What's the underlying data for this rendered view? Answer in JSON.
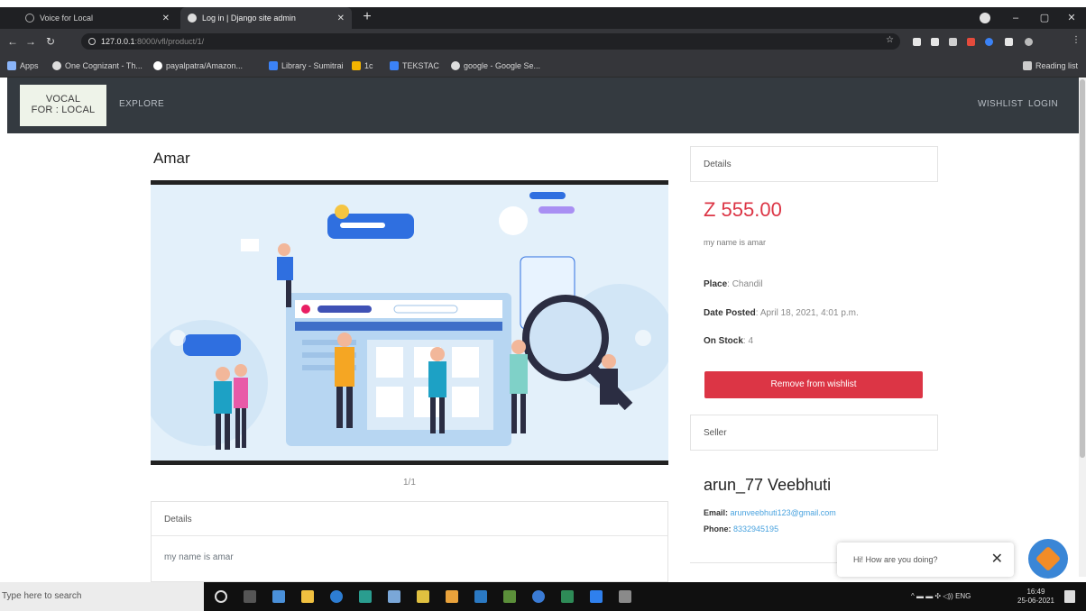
{
  "browser": {
    "tabs": [
      {
        "title": "Voice for Local"
      },
      {
        "title": "Log in | Django site admin",
        "active": true
      }
    ],
    "address": {
      "host": "127.0.0.1",
      "path": ":8000/vfl/product/1/"
    },
    "bookmarks": [
      "Apps",
      "One Cognizant - Th...",
      "payalpatra/Amazon...",
      "Library - Sumitrai",
      "1c",
      "TEKSTAC",
      "google - Google Se..."
    ],
    "reading_list": "Reading list",
    "colors": {
      "chrome": "#35363a",
      "tabstrip": "#1f2023"
    }
  },
  "site": {
    "logo": {
      "line1": "VOCAL",
      "line2": "FOR : LOCAL"
    },
    "nav": {
      "explore": "EXPLORE",
      "wishlist": "WISHLIST",
      "login": "LOGIN"
    },
    "colors": {
      "navbar": "#343a40",
      "accent": "#dc3545"
    }
  },
  "product": {
    "title": "Amar",
    "image_counter": "1/1",
    "details_label": "Details",
    "description": "my name is amar"
  },
  "sidebar": {
    "details_label": "Details",
    "price": "Z 555.00",
    "description": "my name is amar",
    "place_label": "Place",
    "place_value": "Chandil",
    "date_label": "Date Posted",
    "date_value": "April 18, 2021, 4:01 p.m.",
    "stock_label": "On Stock",
    "stock_value": "4",
    "remove_button": "Remove from wishlist",
    "seller_label": "Seller",
    "seller_name": "arun_77 Veebhuti",
    "email_label": "Email:",
    "email_value": "arunveebhuti123@gmail.com",
    "phone_label": "Phone:",
    "phone_value": "8332945195"
  },
  "chat": {
    "message": "Hi! How are you doing?"
  },
  "taskbar": {
    "search_placeholder": "Type here to search",
    "tray": "ENG",
    "time": "16:49",
    "date": "25-06-2021"
  }
}
